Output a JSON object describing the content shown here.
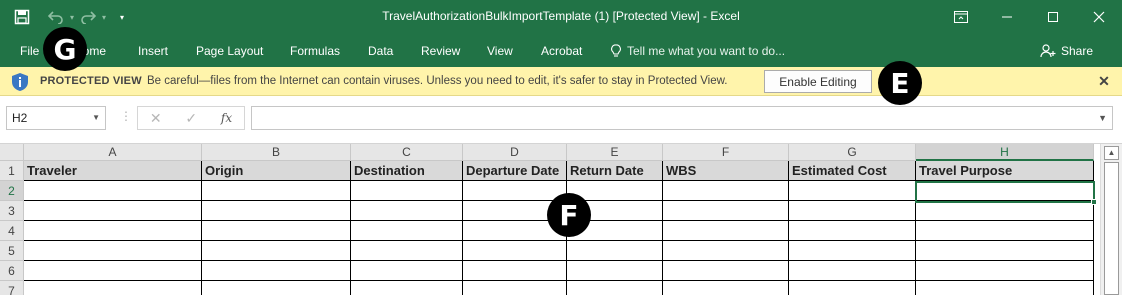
{
  "app": {
    "title": "TravelAuthorizationBulkImportTemplate (1)  [Protected View] - Excel",
    "accent_color": "#217346"
  },
  "quick_access": {
    "save_icon": "save-icon",
    "undo_icon": "undo-icon",
    "redo_icon": "redo-icon",
    "customize_icon": "customize-qat-icon"
  },
  "window_controls": [
    "ribbon-display-icon",
    "minimize-icon",
    "maximize-icon",
    "close-icon"
  ],
  "ribbon": {
    "tabs": [
      "File",
      "Home",
      "Insert",
      "Page Layout",
      "Formulas",
      "Data",
      "Review",
      "View",
      "Acrobat"
    ],
    "tell_me": "Tell me what you want to do...",
    "share": "Share"
  },
  "protected_view": {
    "title": "PROTECTED VIEW",
    "message": "Be careful—files from the Internet can contain viruses. Unless you need to edit, it's safer to stay in Protected View.",
    "button": "Enable Editing",
    "bar_color": "#fff4ab"
  },
  "formula_bar": {
    "name_box": "H2",
    "fx": "fx",
    "value": ""
  },
  "sheet": {
    "columns": [
      "A",
      "B",
      "C",
      "D",
      "E",
      "F",
      "G",
      "H"
    ],
    "rows": [
      "1",
      "2",
      "3",
      "4",
      "5",
      "6",
      "7"
    ],
    "headers": [
      "Traveler",
      "Origin",
      "Destination",
      "Departure Date",
      "Return Date",
      "WBS",
      "Estimated Cost",
      "Travel Purpose"
    ],
    "selected_cell": "H2"
  },
  "markers": {
    "g": "G",
    "e": "E",
    "f": "F"
  }
}
